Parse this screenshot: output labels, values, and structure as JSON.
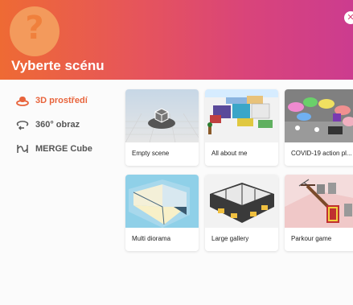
{
  "dialog": {
    "title": "Vyberte scénu",
    "help_glyph": "?",
    "close_glyph": "✕"
  },
  "sidebar": {
    "items": [
      {
        "label": "3D prostředí",
        "icon": "3d-environment-icon",
        "active": true
      },
      {
        "label": "360° obraz",
        "icon": "360-image-icon",
        "active": false
      },
      {
        "label": "MERGE Cube",
        "icon": "merge-cube-icon",
        "active": false
      }
    ]
  },
  "scenes": [
    {
      "label": "Empty scene"
    },
    {
      "label": "All about me"
    },
    {
      "label": "COVID-19 action pl..."
    },
    {
      "label": "Multi diorama"
    },
    {
      "label": "Large gallery"
    },
    {
      "label": "Parkour game"
    }
  ],
  "colors": {
    "accent": "#e8643c",
    "header_start": "#ee6a34",
    "header_end": "#cc3c8f"
  }
}
